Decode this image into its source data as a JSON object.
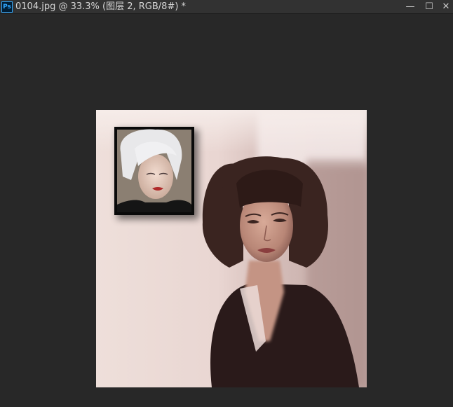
{
  "window": {
    "app_icon_label": "Ps",
    "document_title": "0104.jpg @ 33.3% (图层 2, RGB/8#) *",
    "minimize_glyph": "—",
    "maximize_glyph": "☐",
    "close_glyph": "✕"
  },
  "artwork": {
    "background_color": "#e8d8d3",
    "hair_color": "#3a2420",
    "jacket_color": "#2a1a1a",
    "skin_color": "#c89a88",
    "thumbnail_frame_color": "#0a0a0a"
  }
}
